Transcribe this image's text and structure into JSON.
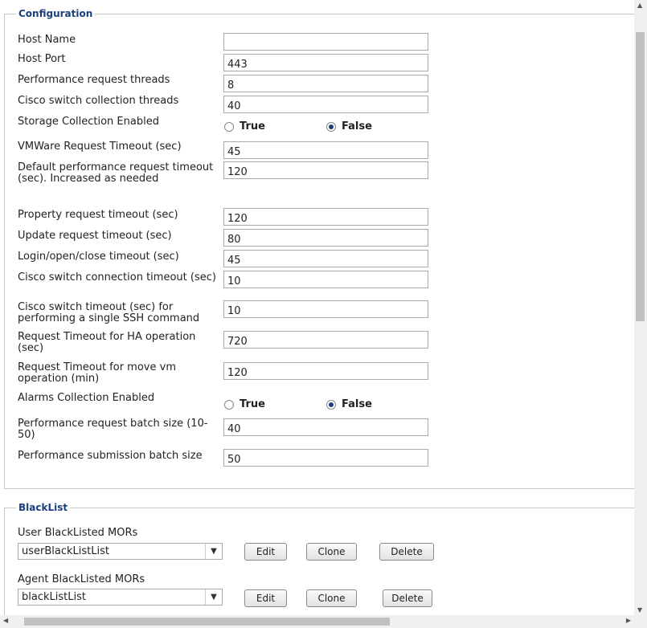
{
  "config": {
    "legend": "Configuration",
    "fields": [
      {
        "label": "Host Name",
        "value": ""
      },
      {
        "label": "Host Port",
        "value": "443"
      },
      {
        "label": "Performance request threads",
        "value": "8"
      },
      {
        "label": "Cisco switch collection threads",
        "value": "40"
      },
      {
        "label": "Storage Collection Enabled",
        "true_label": "True",
        "false_label": "False",
        "selected": "False"
      },
      {
        "label": "VMWare Request Timeout (sec)",
        "value": "45"
      },
      {
        "label": "Default performance request timeout (sec). Increased as needed",
        "value": "120"
      },
      {
        "label": "Property request timeout (sec)",
        "value": "120"
      },
      {
        "label": "Update request timeout (sec)",
        "value": "80"
      },
      {
        "label": "Login/open/close timeout (sec)",
        "value": "45"
      },
      {
        "label": "Cisco switch connection timeout (sec)",
        "value": "10"
      },
      {
        "label": "Cisco switch timeout (sec) for performing a single SSH command",
        "value": "10"
      },
      {
        "label": "Request Timeout for HA operation (sec)",
        "value": "720"
      },
      {
        "label": "Request Timeout for move vm operation (min)",
        "value": "120"
      },
      {
        "label": "Alarms Collection Enabled",
        "true_label": "True",
        "false_label": "False",
        "selected": "False"
      },
      {
        "label": "Performance request batch size (10-50)",
        "value": "40"
      },
      {
        "label": "Performance submission batch size",
        "value": "50"
      }
    ]
  },
  "blacklist": {
    "legend": "BlackList",
    "lists": [
      {
        "label": "User BlackListed MORs",
        "selected": "userBlackListList",
        "edit": "Edit",
        "clone": "Clone",
        "delete": "Delete"
      },
      {
        "label": "Agent BlackListed MORs",
        "selected": "blackListList",
        "edit": "Edit",
        "clone": "Clone",
        "delete": "Delete"
      }
    ]
  },
  "icons": {
    "dropdown": "chevron-down-icon",
    "scroll_up": "arrow-up-icon",
    "scroll_down": "arrow-down-icon"
  },
  "colors": {
    "legend": "#1a3f7a",
    "border": "#c8c8c8",
    "radio_selected": "#1a3f7a"
  }
}
